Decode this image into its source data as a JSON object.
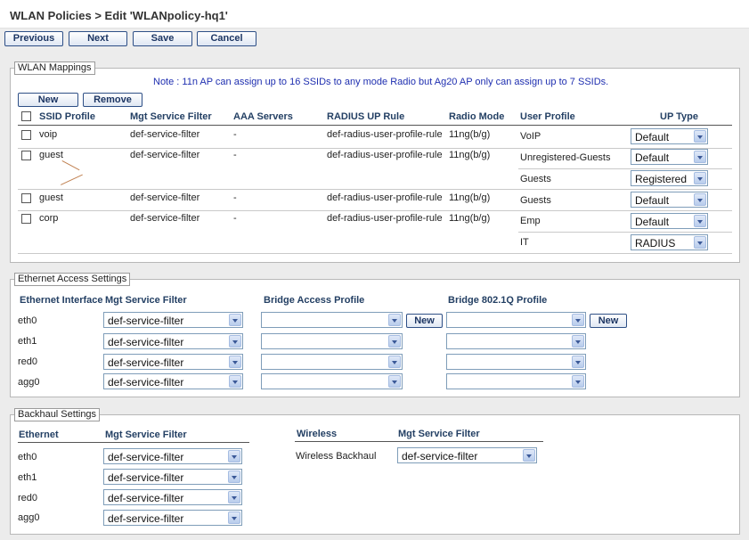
{
  "page": {
    "title": "WLAN Policies > Edit 'WLANpolicy-hq1'"
  },
  "toolbar": {
    "previous": "Previous",
    "next": "Next",
    "save": "Save",
    "cancel": "Cancel"
  },
  "wlan": {
    "legend": "WLAN Mappings",
    "note": "Note : 11n AP can assign up to 16 SSIDs to any mode Radio but Ag20 AP only can assign up to 7 SSIDs.",
    "new_label": "New",
    "remove_label": "Remove",
    "headers": {
      "ssid": "SSID Profile",
      "mgt": "Mgt Service Filter",
      "aaa": "AAA Servers",
      "radius": "RADIUS UP Rule",
      "radio": "Radio Mode",
      "user": "User Profile",
      "uptype": "UP Type"
    },
    "rows": [
      {
        "ssid": "voip",
        "mgt": "def-service-filter",
        "aaa": "-",
        "radius": "def-radius-user-profile-rule",
        "radio": "11ng(b/g)",
        "profiles": [
          {
            "name": "VoIP",
            "type": "Default"
          }
        ]
      },
      {
        "ssid": "guest",
        "mgt": "def-service-filter",
        "aaa": "-",
        "radius": "def-radius-user-profile-rule",
        "radio": "11ng(b/g)",
        "profiles": [
          {
            "name": "Unregistered-Guests",
            "type": "Default"
          },
          {
            "name": "Guests",
            "type": "Registered"
          }
        ]
      },
      {
        "ssid": "guest",
        "mgt": "def-service-filter",
        "aaa": "-",
        "radius": "def-radius-user-profile-rule",
        "radio": "11ng(b/g)",
        "profiles": [
          {
            "name": "Guests",
            "type": "Default"
          }
        ]
      },
      {
        "ssid": "corp",
        "mgt": "def-service-filter",
        "aaa": "-",
        "radius": "def-radius-user-profile-rule",
        "radio": "11ng(b/g)",
        "profiles": [
          {
            "name": "Emp",
            "type": "Default"
          },
          {
            "name": "IT",
            "type": "RADIUS"
          }
        ]
      }
    ]
  },
  "ethernet": {
    "legend": "Ethernet Access Settings",
    "headers": {
      "iface": "Ethernet Interface",
      "mgt": "Mgt Service Filter",
      "bridge": "Bridge Access Profile",
      "dot1q": "Bridge 802.1Q Profile"
    },
    "new_label": "New",
    "rows": [
      {
        "iface": "eth0",
        "mgt": "def-service-filter",
        "bridge": "",
        "dot1q": ""
      },
      {
        "iface": "eth1",
        "mgt": "def-service-filter",
        "bridge": "",
        "dot1q": ""
      },
      {
        "iface": "red0",
        "mgt": "def-service-filter",
        "bridge": "",
        "dot1q": ""
      },
      {
        "iface": "agg0",
        "mgt": "def-service-filter",
        "bridge": "",
        "dot1q": ""
      }
    ]
  },
  "backhaul": {
    "legend": "Backhaul Settings",
    "headers": {
      "ethernet": "Ethernet",
      "mgt": "Mgt Service Filter",
      "wireless": "Wireless",
      "wmgt": "Mgt Service Filter"
    },
    "rows": [
      {
        "iface": "eth0",
        "mgt": "def-service-filter"
      },
      {
        "iface": "eth1",
        "mgt": "def-service-filter"
      },
      {
        "iface": "red0",
        "mgt": "def-service-filter"
      },
      {
        "iface": "agg0",
        "mgt": "def-service-filter"
      }
    ],
    "wireless_row": {
      "label": "Wireless Backhaul",
      "mgt": "def-service-filter"
    }
  }
}
